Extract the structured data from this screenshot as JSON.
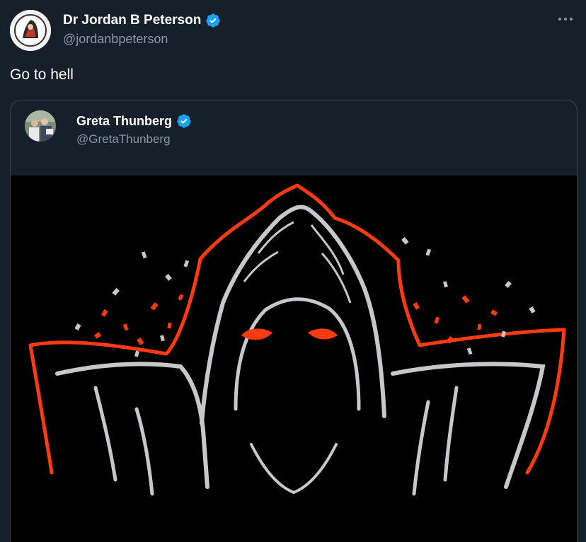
{
  "tweet": {
    "author": {
      "display_name": "Dr Jordan B Peterson",
      "handle": "@jordanbpeterson",
      "verified": true,
      "avatar_icon": "profile-photo"
    },
    "text": "Go to hell",
    "more_icon": "more-options-icon"
  },
  "quoted_tweet": {
    "author": {
      "display_name": "Greta Thunberg",
      "handle": "@GretaThunberg",
      "verified": true,
      "avatar_icon": "profile-photo"
    },
    "media_icon": "hooded-figure-illustration"
  },
  "colors": {
    "background": "#15202b",
    "secondary_text": "#8899a6",
    "border": "#38444d",
    "verified_blue": "#1da1f2",
    "illustration_orange": "#ff3b0f",
    "illustration_grey": "#c8c8cc"
  }
}
